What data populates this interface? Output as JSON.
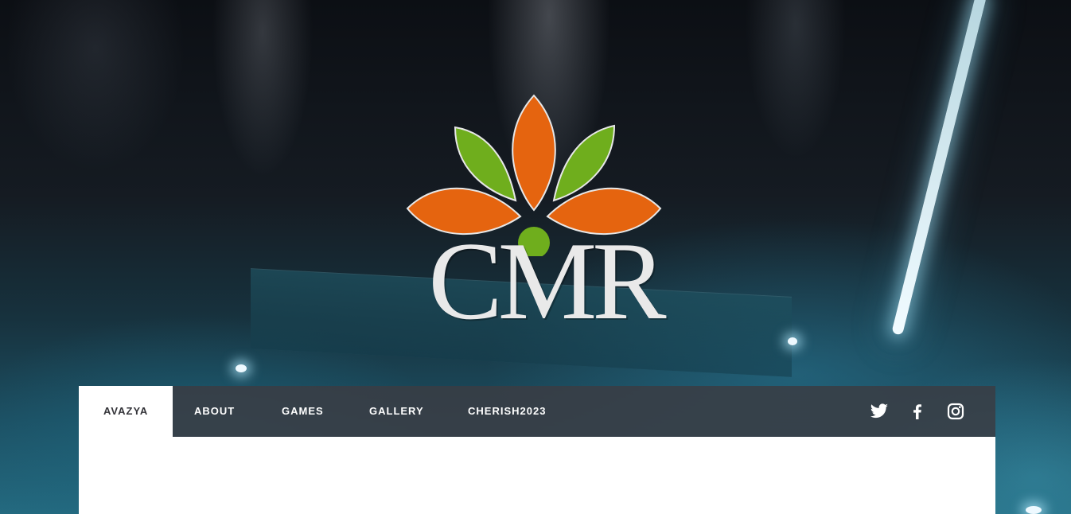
{
  "brand": {
    "logo_text": "CMR",
    "colors": {
      "petal_orange": "#e5640f",
      "petal_green": "#6fae1d",
      "text": "#e9e9e9"
    }
  },
  "nav": {
    "items": [
      {
        "label": "AVAZYA",
        "active": true
      },
      {
        "label": "ABOUT",
        "active": false
      },
      {
        "label": "GAMES",
        "active": false
      },
      {
        "label": "GALLERY",
        "active": false
      },
      {
        "label": "CHERISH2023",
        "active": false
      }
    ],
    "social": [
      {
        "icon": "twitter-icon"
      },
      {
        "icon": "facebook-icon"
      },
      {
        "icon": "instagram-icon"
      }
    ]
  }
}
